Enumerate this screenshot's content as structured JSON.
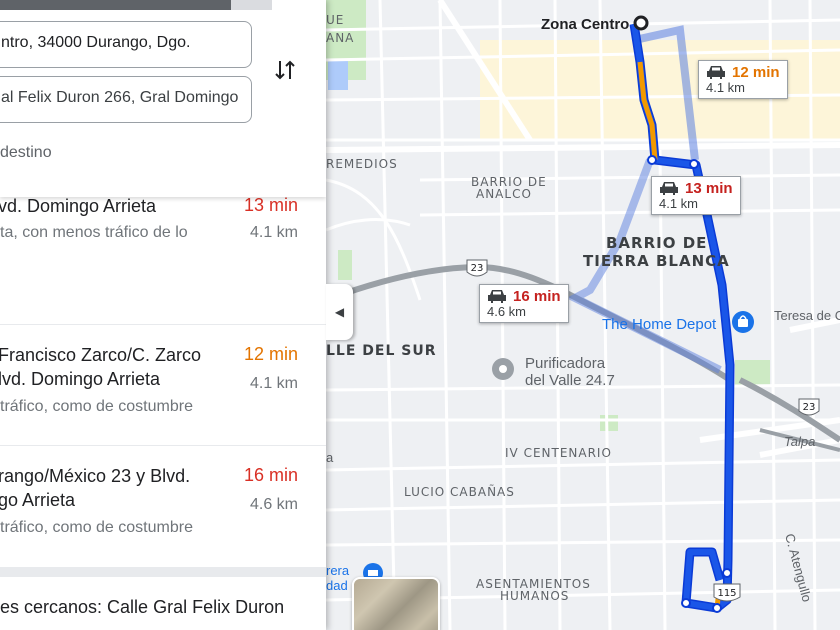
{
  "map": {
    "origin_label": "Zona Centro",
    "neighborhoods": {
      "barrio_analco_1": "BARRIO DE",
      "barrio_analco_2": "ANALCO",
      "tierra_blanca_1": "BARRIO DE",
      "tierra_blanca_2": "TIERRA BLANCA",
      "remedios": "REMEDIOS",
      "valle_del_sur": "LLE DEL SUR",
      "iv_centenario": "IV CENTENARIO",
      "lucio_cabanas": "LUCIO CABAÑAS",
      "asentamientos_1": "ASENTAMIENTOS",
      "asentamientos_2": "HUMANOS",
      "ana": "ANA",
      "ue": "UE"
    },
    "pois": {
      "purificadora_1": "Purificadora",
      "purificadora_2": "del Valle 24.7",
      "home_depot": "The Home Depot",
      "teresa": "Teresa de C",
      "talpa": "Talpa",
      "atengullo": "C. Atengullo",
      "rera_1": "rera",
      "rera_2": "dad",
      "a_edge": "a"
    },
    "shields": {
      "road_23_left": "23",
      "road_23_right": "23",
      "road_115": "115"
    },
    "callouts": [
      {
        "id": "top",
        "time": "12 min",
        "distance": "4.1 km",
        "color": "orange"
      },
      {
        "id": "mid",
        "time": "13 min",
        "distance": "4.1 km",
        "color": "red"
      },
      {
        "id": "left",
        "time": "16 min",
        "distance": "4.6 km",
        "color": "red"
      }
    ],
    "colors": {
      "route_primary": "#1a56e8",
      "route_alt": "#8fb1f0",
      "traffic_slow": "#f29900"
    }
  },
  "panel": {
    "progress_fraction": 0.85,
    "origin_field": "ntro, 34000 Durango, Dgo.",
    "destination_field": "al Felix Duron 266, Gral Domingo",
    "add_destination": "destino",
    "swap_icon": "swap-vertical-icon",
    "routes": [
      {
        "name_line1": "vd. Domingo Arrieta",
        "name_line2": "",
        "detail": "ta, con menos tráfico de lo",
        "time": "13 min",
        "distance": "4.1 km",
        "time_color": "red"
      },
      {
        "name_line1": "Francisco Zarco/C. Zarco",
        "name_line2": "lvd. Domingo Arrieta",
        "detail": "tráfico, como de costumbre",
        "time": "12 min",
        "distance": "4.1 km",
        "time_color": "orange"
      },
      {
        "name_line1": "rango/México 23 y Blvd.",
        "name_line2": "go Arrieta",
        "detail": "tráfico, como de costumbre",
        "time": "16 min",
        "distance": "4.6 km",
        "time_color": "red"
      }
    ],
    "nearby": "es cercanos: Calle Gral Felix Duron"
  }
}
